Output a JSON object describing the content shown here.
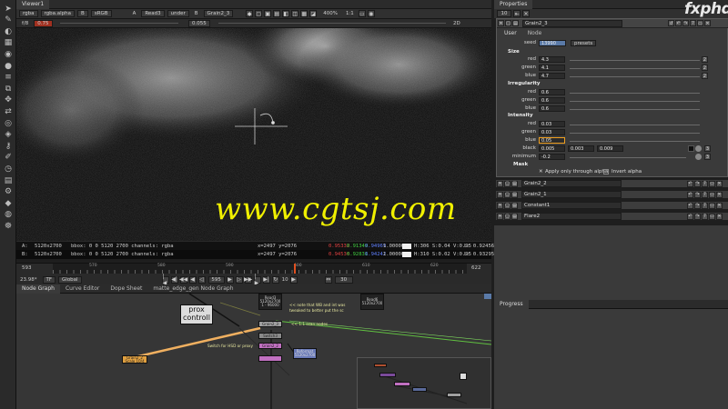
{
  "colors": {
    "accent": "#f0f000",
    "playhead": "#e05020",
    "red_value": "#e04040",
    "green_value": "#40d040",
    "blue_value": "#5070ff",
    "seed_field": "#5a7aa8"
  },
  "left_toolbar": {
    "icons": [
      "cursor-icon",
      "pencil-icon",
      "gradient-icon",
      "channel-icon",
      "color-icon",
      "circle-icon",
      "layers-icon",
      "merge-icon",
      "transform-icon",
      "shuffle-icon",
      "eye-icon",
      "filter-icon",
      "keyer-icon",
      "brush-icon",
      "time-icon",
      "grid-icon",
      "gear-icon",
      "3d-icon",
      "globe-icon",
      "settings-icon"
    ]
  },
  "viewer": {
    "tab_label": "Viewer1",
    "channels": "rgba",
    "alpha": "rgba.alpha",
    "channel_b": "B",
    "colorspace": "sRGB",
    "input_a": "A",
    "input_a_node": "Read3",
    "compare_mode": "under",
    "input_b": "B",
    "input_b_node": "Grain2_3",
    "zoom": "400%",
    "ratio": "1:1",
    "gain_label": "f/8",
    "gain_value": "0.75",
    "gamma_value": "0.055",
    "view_mode": "2D",
    "bbox_label": "bbox"
  },
  "info": {
    "a_label": "A:",
    "a_format": "5120x2700",
    "a_bbox": "bbox: 0 0 5120 2700 channels: rgba",
    "a_coords": "x=2497 y=2076",
    "a_r": "0.95332",
    "a_g": "0.91349",
    "a_b": "0.94969",
    "a_a": "1.00000",
    "a_hsl": "H:306 S:0.04 V:0.95",
    "a_l": "L: 0.92456",
    "b_label": "B:",
    "b_format": "5120x2700",
    "b_bbox": "bbox: 0 0 5120 2700 channels: rgba",
    "b_coords": "x=2497 y=2076",
    "b_r": "0.94536",
    "b_g": "0.92831",
    "b_b": "0.94242",
    "b_a": "1.00000",
    "b_hsl": "H:310 S:0.02 V:0.95",
    "b_l": "L: 0.93295"
  },
  "timeline": {
    "start": "593",
    "end": "622",
    "ticks": [
      "570",
      "580",
      "590",
      "600",
      "610",
      "620"
    ],
    "current_frame": "595",
    "fps": "23.98*",
    "tf_label": "TF",
    "range_mode": "Global",
    "step": "10",
    "end_field": "30"
  },
  "node_graph": {
    "tabs": [
      "Node Graph",
      "Curve Editor",
      "Dope Sheet",
      "matte_edge_gen Node Graph"
    ],
    "backdrop_label": "prox\ncontroll",
    "nodes": {
      "read3": "Read3\n5120x2700\n1 - 96000",
      "read6": "Read6\n5120x2700",
      "grain2": "Grain2_3",
      "switch": "Switch3",
      "grain2_2": "Grain2_2",
      "reformat": "Reformat\n5120x2700",
      "grain_node_left": "Grain2_2\nScale 10/4"
    },
    "notes": {
      "note1": "<< note that WB and int was",
      "note2": "tweaked to better put the sc",
      "note3": "<< 1:1 scan nodes",
      "note4": "Switch for HSD or proxy"
    }
  },
  "properties": {
    "tab_label": "Properties",
    "count_field": "10",
    "node_name": "Grain2_3",
    "subtabs": [
      "User",
      "Node"
    ],
    "seed_label": "seed",
    "seed_value": "13990",
    "presets_label": "presets",
    "size_section": "Size",
    "irregularity_section": "Irregularity",
    "intensity_section": "Intensity",
    "mask_section": "Mask",
    "red_label": "red",
    "green_label": "green",
    "blue_label": "blue",
    "size": {
      "red": "4.3",
      "green": "4.1",
      "blue": "4.7"
    },
    "irregularity": {
      "red": "0.6",
      "green": "0.6",
      "blue": "0.6"
    },
    "intensity": {
      "red": "0.03",
      "green": "0.03",
      "blue": "0.05"
    },
    "black_label": "black",
    "black": [
      "0.005",
      "0.003",
      "0.009"
    ],
    "minimum_label": "minimum",
    "minimum_value": "-0.2",
    "badge": "2",
    "apply_alpha_label": "Apply only through alpha",
    "invert_alpha_label": "Invert alpha",
    "collapsed_nodes": [
      "Grain2_2",
      "Grain2_1",
      "Constant1",
      "Flare2"
    ]
  },
  "progress": {
    "tab_label": "Progress"
  },
  "watermark": {
    "text": "www.cgtsj.com",
    "logo": "fxphd"
  }
}
